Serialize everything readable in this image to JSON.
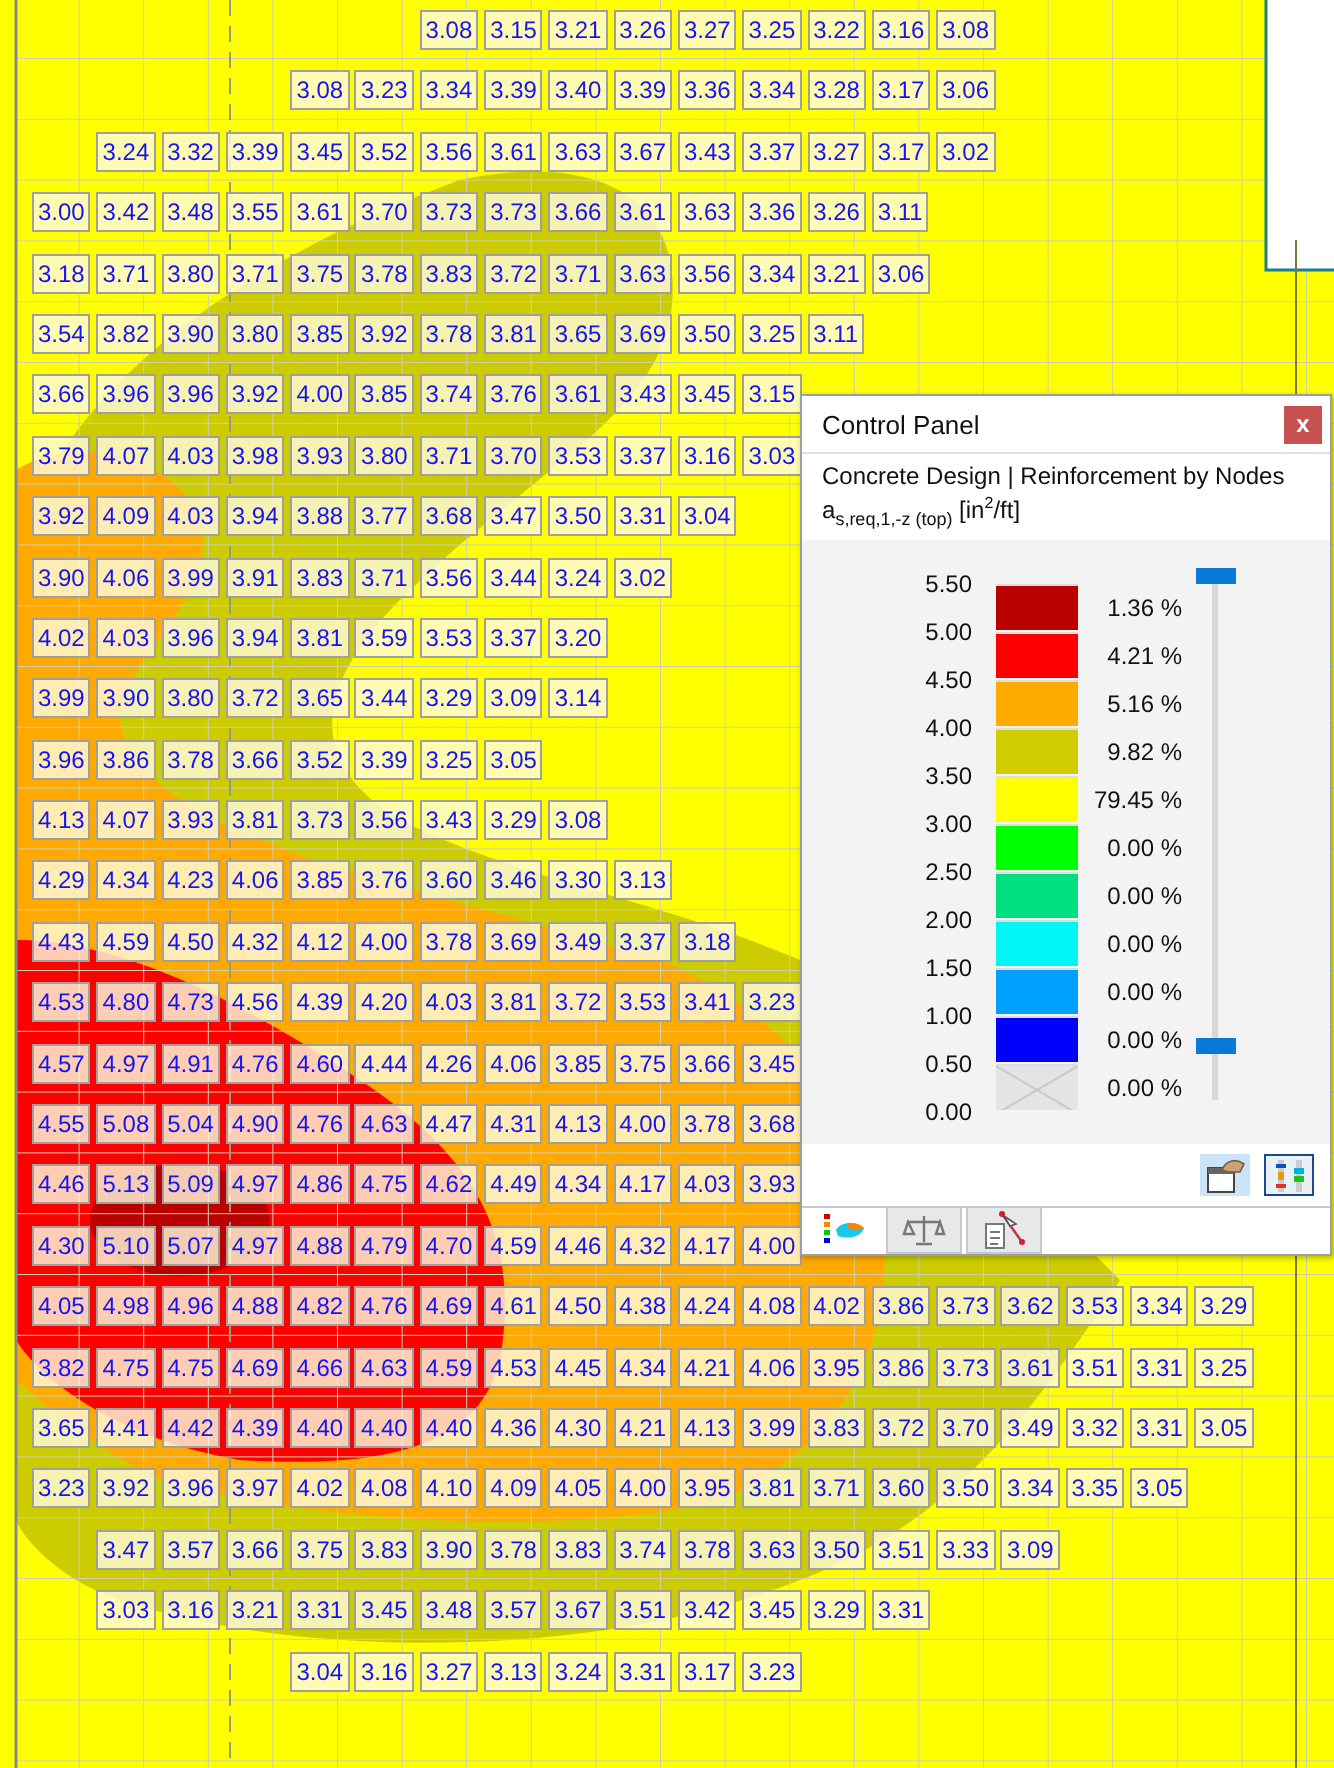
{
  "plot": {
    "rows": [
      [
        null,
        null,
        null,
        null,
        null,
        null,
        "3.08",
        "3.15",
        "3.21",
        "3.26",
        "3.27",
        "3.25",
        "3.22",
        "3.16",
        "3.08"
      ],
      [
        null,
        null,
        null,
        null,
        "3.08",
        "3.23",
        "3.34",
        "3.39",
        "3.40",
        "3.39",
        "3.36",
        "3.34",
        "3.28",
        "3.17",
        "3.06"
      ],
      [
        null,
        "3.24",
        "3.32",
        "3.39",
        "3.45",
        "3.52",
        "3.56",
        "3.61",
        "3.63",
        "3.67",
        "3.43",
        "3.37",
        "3.27",
        "3.17",
        "3.02"
      ],
      [
        "3.00",
        "3.42",
        "3.48",
        "3.55",
        "3.61",
        "3.70",
        "3.73",
        "3.73",
        "3.66",
        "3.61",
        "3.63",
        "3.36",
        "3.26",
        "3.11"
      ],
      [
        "3.18",
        "3.71",
        "3.80",
        "3.71",
        "3.75",
        "3.78",
        "3.83",
        "3.72",
        "3.71",
        "3.63",
        "3.56",
        "3.34",
        "3.21",
        "3.06"
      ],
      [
        "3.54",
        "3.82",
        "3.90",
        "3.80",
        "3.85",
        "3.92",
        "3.78",
        "3.81",
        "3.65",
        "3.69",
        "3.50",
        "3.25",
        "3.11"
      ],
      [
        "3.66",
        "3.96",
        "3.96",
        "3.92",
        "4.00",
        "3.85",
        "3.74",
        "3.76",
        "3.61",
        "3.43",
        "3.45",
        "3.15"
      ],
      [
        "3.79",
        "4.07",
        "4.03",
        "3.98",
        "3.93",
        "3.80",
        "3.71",
        "3.70",
        "3.53",
        "3.37",
        "3.16",
        "3.03"
      ],
      [
        "3.92",
        "4.09",
        "4.03",
        "3.94",
        "3.88",
        "3.77",
        "3.68",
        "3.47",
        "3.50",
        "3.31",
        "3.04"
      ],
      [
        "3.90",
        "4.06",
        "3.99",
        "3.91",
        "3.83",
        "3.71",
        "3.56",
        "3.44",
        "3.24",
        "3.02"
      ],
      [
        "4.02",
        "4.03",
        "3.96",
        "3.94",
        "3.81",
        "3.59",
        "3.53",
        "3.37",
        "3.20"
      ],
      [
        "3.99",
        "3.90",
        "3.80",
        "3.72",
        "3.65",
        "3.44",
        "3.29",
        "3.09",
        "3.14"
      ],
      [
        "3.96",
        "3.86",
        "3.78",
        "3.66",
        "3.52",
        "3.39",
        "3.25",
        "3.05"
      ],
      [
        "4.13",
        "4.07",
        "3.93",
        "3.81",
        "3.73",
        "3.56",
        "3.43",
        "3.29",
        "3.08"
      ],
      [
        "4.29",
        "4.34",
        "4.23",
        "4.06",
        "3.85",
        "3.76",
        "3.60",
        "3.46",
        "3.30",
        "3.13"
      ],
      [
        "4.43",
        "4.59",
        "4.50",
        "4.32",
        "4.12",
        "4.00",
        "3.78",
        "3.69",
        "3.49",
        "3.37",
        "3.18"
      ],
      [
        "4.53",
        "4.80",
        "4.73",
        "4.56",
        "4.39",
        "4.20",
        "4.03",
        "3.81",
        "3.72",
        "3.53",
        "3.41",
        "3.23"
      ],
      [
        "4.57",
        "4.97",
        "4.91",
        "4.76",
        "4.60",
        "4.44",
        "4.26",
        "4.06",
        "3.85",
        "3.75",
        "3.66",
        "3.45"
      ],
      [
        "4.55",
        "5.08",
        "5.04",
        "4.90",
        "4.76",
        "4.63",
        "4.47",
        "4.31",
        "4.13",
        "4.00",
        "3.78",
        "3.68"
      ],
      [
        "4.46",
        "5.13",
        "5.09",
        "4.97",
        "4.86",
        "4.75",
        "4.62",
        "4.49",
        "4.34",
        "4.17",
        "4.03",
        "3.93"
      ],
      [
        "4.30",
        "5.10",
        "5.07",
        "4.97",
        "4.88",
        "4.79",
        "4.70",
        "4.59",
        "4.46",
        "4.32",
        "4.17",
        "4.00"
      ],
      [
        "4.05",
        "4.98",
        "4.96",
        "4.88",
        "4.82",
        "4.76",
        "4.69",
        "4.61",
        "4.50",
        "4.38",
        "4.24",
        "4.08",
        "4.02",
        "3.86",
        "3.73",
        "3.62",
        "3.53",
        "3.34",
        "3.29"
      ],
      [
        "3.82",
        "4.75",
        "4.75",
        "4.69",
        "4.66",
        "4.63",
        "4.59",
        "4.53",
        "4.45",
        "4.34",
        "4.21",
        "4.06",
        "3.95",
        "3.86",
        "3.73",
        "3.61",
        "3.51",
        "3.31",
        "3.25"
      ],
      [
        "3.65",
        "4.41",
        "4.42",
        "4.39",
        "4.40",
        "4.40",
        "4.40",
        "4.36",
        "4.30",
        "4.21",
        "4.13",
        "3.99",
        "3.83",
        "3.72",
        "3.70",
        "3.49",
        "3.32",
        "3.31",
        "3.05"
      ],
      [
        "3.23",
        "3.92",
        "3.96",
        "3.97",
        "4.02",
        "4.08",
        "4.10",
        "4.09",
        "4.05",
        "4.00",
        "3.95",
        "3.81",
        "3.71",
        "3.60",
        "3.50",
        "3.34",
        "3.35",
        "3.05"
      ],
      [
        null,
        "3.47",
        "3.57",
        "3.66",
        "3.75",
        "3.83",
        "3.90",
        "3.78",
        "3.83",
        "3.74",
        "3.78",
        "3.63",
        "3.50",
        "3.51",
        "3.33",
        "3.09"
      ],
      [
        null,
        "3.03",
        "3.16",
        "3.21",
        "3.31",
        "3.45",
        "3.48",
        "3.57",
        "3.67",
        "3.51",
        "3.42",
        "3.45",
        "3.29",
        "3.31"
      ],
      [
        null,
        null,
        null,
        null,
        "3.04",
        "3.16",
        "3.27",
        "3.13",
        "3.24",
        "3.31",
        "3.17",
        "3.23"
      ]
    ]
  },
  "control_panel": {
    "title": "Control Panel",
    "close": "x",
    "heading": "Concrete Design | Reinforcement by Nodes",
    "quantity": "a$_{s,req,1,-z (top)}$ [in$^{2}$/ft]",
    "scale": [
      "5.50",
      "5.00",
      "4.50",
      "4.00",
      "3.50",
      "3.00",
      "2.50",
      "2.00",
      "1.50",
      "1.00",
      "0.50",
      "0.00"
    ],
    "legend": [
      {
        "kind": "color",
        "color": "#bb0000",
        "percent": "1.36 %"
      },
      {
        "kind": "color",
        "color": "#ff0000",
        "percent": "4.21 %"
      },
      {
        "kind": "color",
        "color": "#ffaa00",
        "percent": "5.16 %"
      },
      {
        "kind": "color",
        "color": "#d0cc00",
        "percent": "9.82 %"
      },
      {
        "kind": "color",
        "color": "#ffff00",
        "percent": "79.45 %"
      },
      {
        "kind": "color",
        "color": "#00ff00",
        "percent": "0.00 %"
      },
      {
        "kind": "color",
        "color": "#00e080",
        "percent": "0.00 %"
      },
      {
        "kind": "color",
        "color": "#00f5f5",
        "percent": "0.00 %"
      },
      {
        "kind": "color",
        "color": "#00a0ff",
        "percent": "0.00 %"
      },
      {
        "kind": "color",
        "color": "#0000ff",
        "percent": "0.00 %"
      },
      {
        "kind": "empty",
        "percent": "0.00 %"
      }
    ],
    "range_thumbs": [
      {
        "level": 1
      },
      {
        "level": 0.09
      }
    ],
    "buttons": [
      {
        "kind": "window",
        "on": false
      },
      {
        "kind": "bars",
        "on": true
      }
    ],
    "tabs": [
      {
        "kind": "legend",
        "selected": true
      },
      {
        "kind": "scale",
        "selected": false
      },
      {
        "kind": "pointer",
        "selected": false
      }
    ]
  }
}
